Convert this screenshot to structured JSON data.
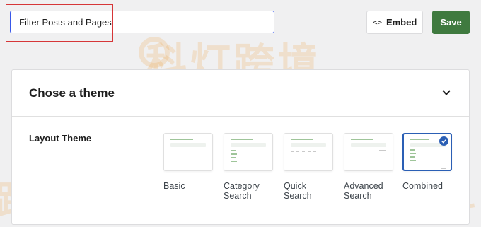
{
  "search": {
    "value": "Filter Posts and Pages"
  },
  "toolbar": {
    "embed_label": "Embed",
    "embed_icon": "code-icon",
    "save_label": "Save",
    "save_color": "#3f7a3f"
  },
  "watermark": {
    "main": "科灯跨境",
    "left": "跨境",
    "right": "科"
  },
  "panel": {
    "title": "Chose a theme",
    "layout_label": "Layout Theme",
    "themes": [
      {
        "label": "Basic",
        "selected": false
      },
      {
        "label": "Category Search",
        "selected": false
      },
      {
        "label": "Quick Search",
        "selected": false
      },
      {
        "label": "Advanced Search",
        "selected": false
      },
      {
        "label": "Combined",
        "selected": true
      }
    ]
  },
  "colors": {
    "accent": "#3858e9",
    "selected": "#2b5fb5",
    "highlight": "#d63638"
  }
}
